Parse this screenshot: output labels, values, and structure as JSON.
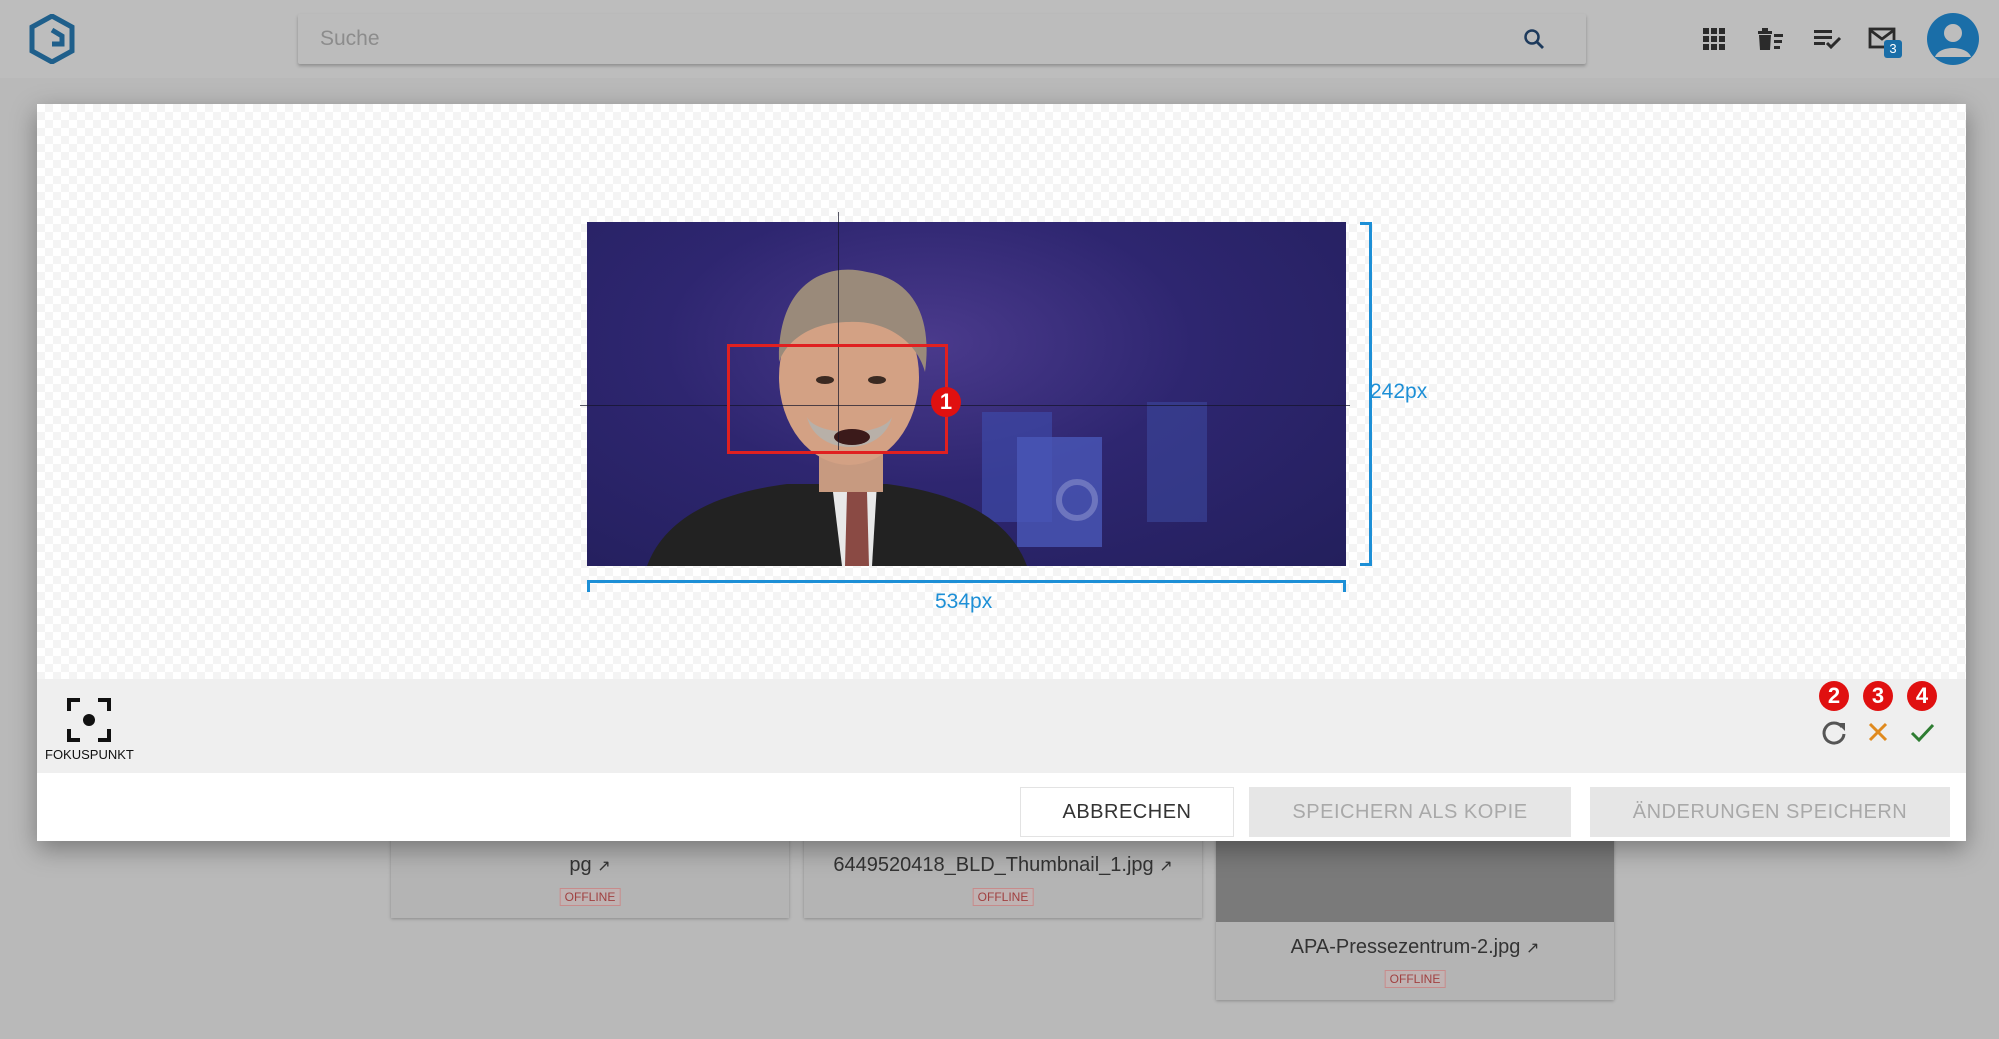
{
  "header": {
    "search_placeholder": "Suche",
    "mail_count": "3",
    "icons": [
      "apps-grid-icon",
      "trash-list-icon",
      "checklist-icon",
      "mail-icon",
      "account-icon"
    ]
  },
  "background_cards": [
    {
      "filename": "pg",
      "status": "OFFLINE"
    },
    {
      "filename": "6449520418_BLD_Thumbnail_1.jpg",
      "status": "OFFLINE"
    },
    {
      "filename": "APA-Pressezentrum-2.jpg",
      "status": "OFFLINE"
    }
  ],
  "editor": {
    "width_label": "534px",
    "height_label": "242px",
    "markers": [
      "1",
      "2",
      "3",
      "4"
    ],
    "tool_label": "FOKUSPUNKT",
    "action_icons": [
      "reset-icon",
      "discard-icon",
      "apply-icon"
    ]
  },
  "footer": {
    "cancel_label": "ABBRECHEN",
    "save_copy_label": "SPEICHERN ALS KOPIE",
    "save_label": "ÄNDERUNGEN SPEICHERN"
  },
  "colors": {
    "accent": "#1d8fd6",
    "marker": "#e01010",
    "discard": "#e08a1e",
    "apply": "#2e7d32"
  }
}
